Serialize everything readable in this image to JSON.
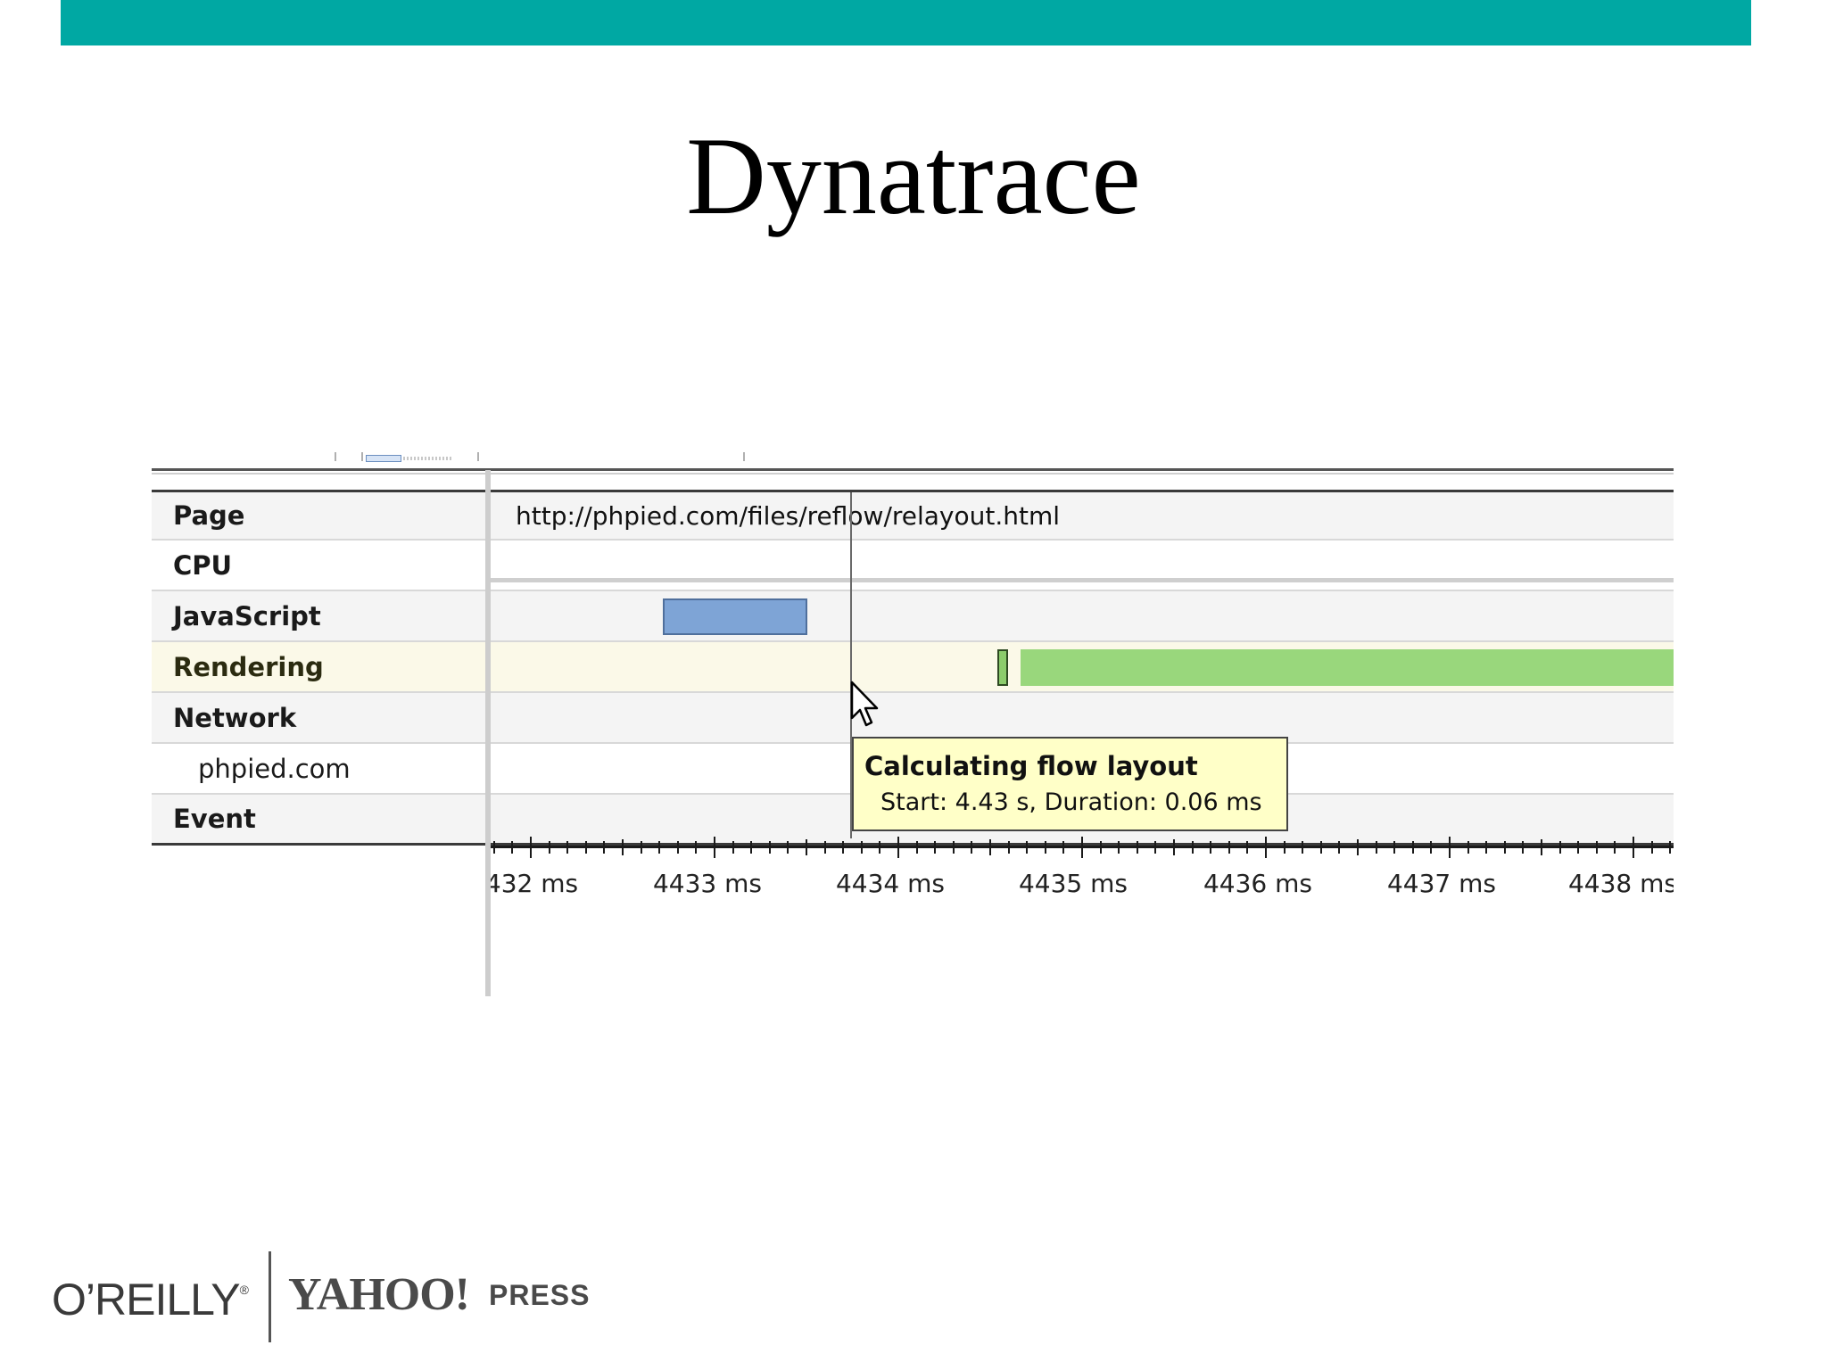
{
  "slide": {
    "title": "Dynatrace",
    "accent_color": "#00a8a3"
  },
  "timeline": {
    "rows": [
      {
        "label": "Page",
        "value": "http://phpied.com/files/reflow/relayout.html"
      },
      {
        "label": "CPU"
      },
      {
        "label": "JavaScript"
      },
      {
        "label": "Rendering"
      },
      {
        "label": "Network"
      },
      {
        "label": "phpied.com"
      },
      {
        "label": "Event"
      }
    ],
    "axis": {
      "labels": [
        "432 ms",
        "4433 ms",
        "4434 ms",
        "4435 ms",
        "4436 ms",
        "4437 ms",
        "4438 ms"
      ]
    },
    "colors": {
      "javascript_bar": "#7ea4d6",
      "rendering_bar": "#99d77c",
      "tooltip_bg": "#ffffc8"
    }
  },
  "tooltip": {
    "title": "Calculating flow layout",
    "detail": "Start: 4.43 s, Duration: 0.06 ms"
  },
  "footer": {
    "publisher": "O’REILLY",
    "publisher_mark": "®",
    "partner": "YAHOO!",
    "partner_suffix": "PRESS"
  }
}
